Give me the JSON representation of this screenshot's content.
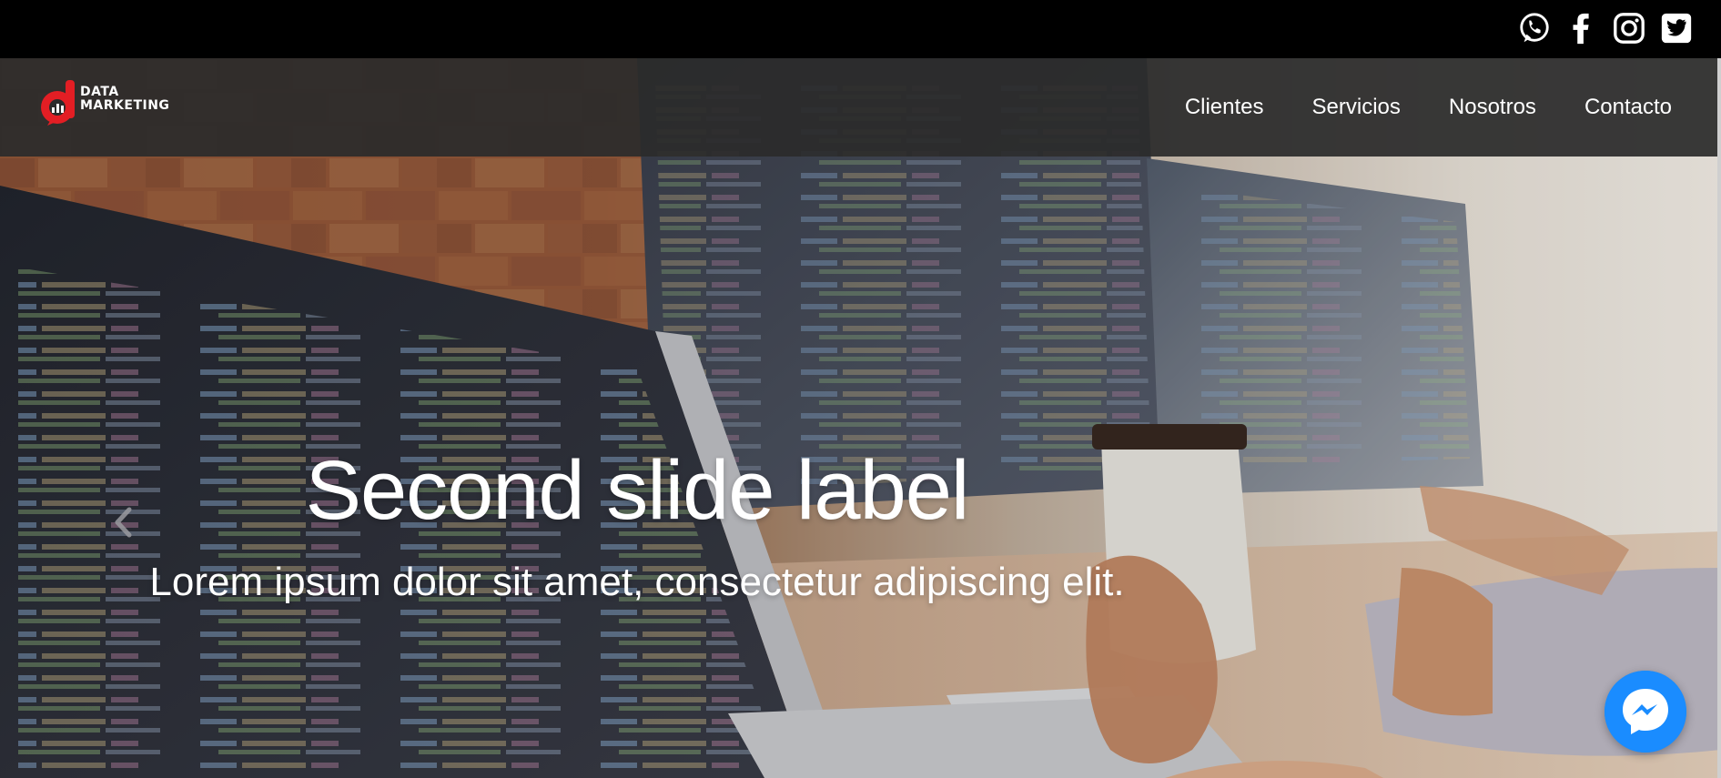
{
  "social": {
    "icons": [
      "whatsapp-icon",
      "facebook-icon",
      "instagram-icon",
      "twitter-icon"
    ]
  },
  "brand": {
    "line1": "DATA",
    "line2": "MARKETING",
    "accent_color": "#e31e24"
  },
  "nav": {
    "items": [
      {
        "label": "Clientes"
      },
      {
        "label": "Servicios"
      },
      {
        "label": "Nosotros"
      },
      {
        "label": "Contacto"
      }
    ]
  },
  "carousel": {
    "title": "Second slide label",
    "text": "Lorem ipsum dolor sit amet, consectetur adipiscing elit.",
    "prev_icon": "chevron-left-icon"
  },
  "chat": {
    "icon": "messenger-icon",
    "color": "#1a8cff"
  }
}
